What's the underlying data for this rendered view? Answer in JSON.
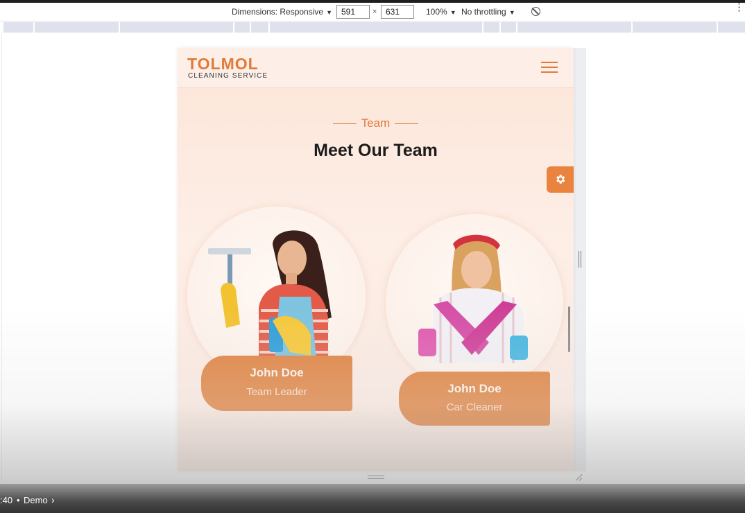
{
  "devtools": {
    "dimensions_label": "Dimensions: Responsive",
    "width_value": "591",
    "height_value": "631",
    "times": "×",
    "zoom": "100%",
    "throttling": "No throttling",
    "caret": "▼",
    "more_icon": "⋮"
  },
  "site": {
    "logo_main": "TOLMOL",
    "logo_sub": "CLEANING SERVICE",
    "eyebrow": "Team",
    "title": "Meet Our Team",
    "accent_color": "#e07b39",
    "members": [
      {
        "name": "John Doe",
        "role": "Team Leader"
      },
      {
        "name": "John Doe",
        "role": "Car Cleaner"
      }
    ]
  },
  "video": {
    "time": ":40",
    "separator": "•",
    "chapter": "Demo",
    "chevron": "›"
  }
}
